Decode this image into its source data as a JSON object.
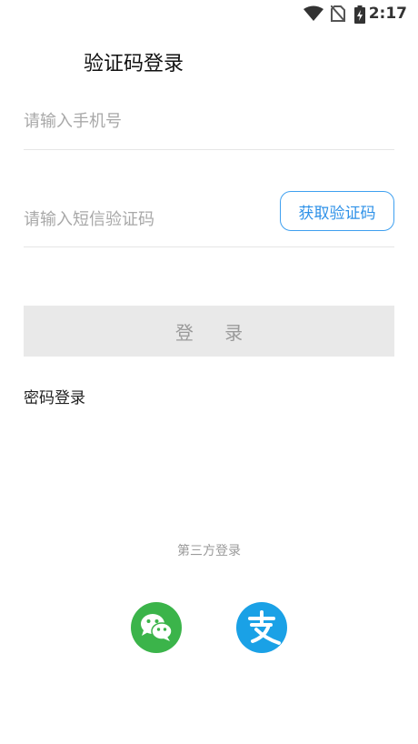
{
  "status_bar": {
    "time": "2:17"
  },
  "title": "验证码登录",
  "phone": {
    "placeholder": "请输入手机号"
  },
  "sms": {
    "placeholder": "请输入短信验证码",
    "button_label": "获取验证码"
  },
  "login_button_label": "登 录",
  "password_login_link": "密码登录",
  "third_party": {
    "label": "第三方登录",
    "providers": [
      "wechat",
      "alipay"
    ]
  },
  "colors": {
    "accent": "#2e91e8",
    "wechat": "#3bb44a",
    "alipay": "#1aa1e6",
    "disabled_button": "#e9e9e9"
  }
}
